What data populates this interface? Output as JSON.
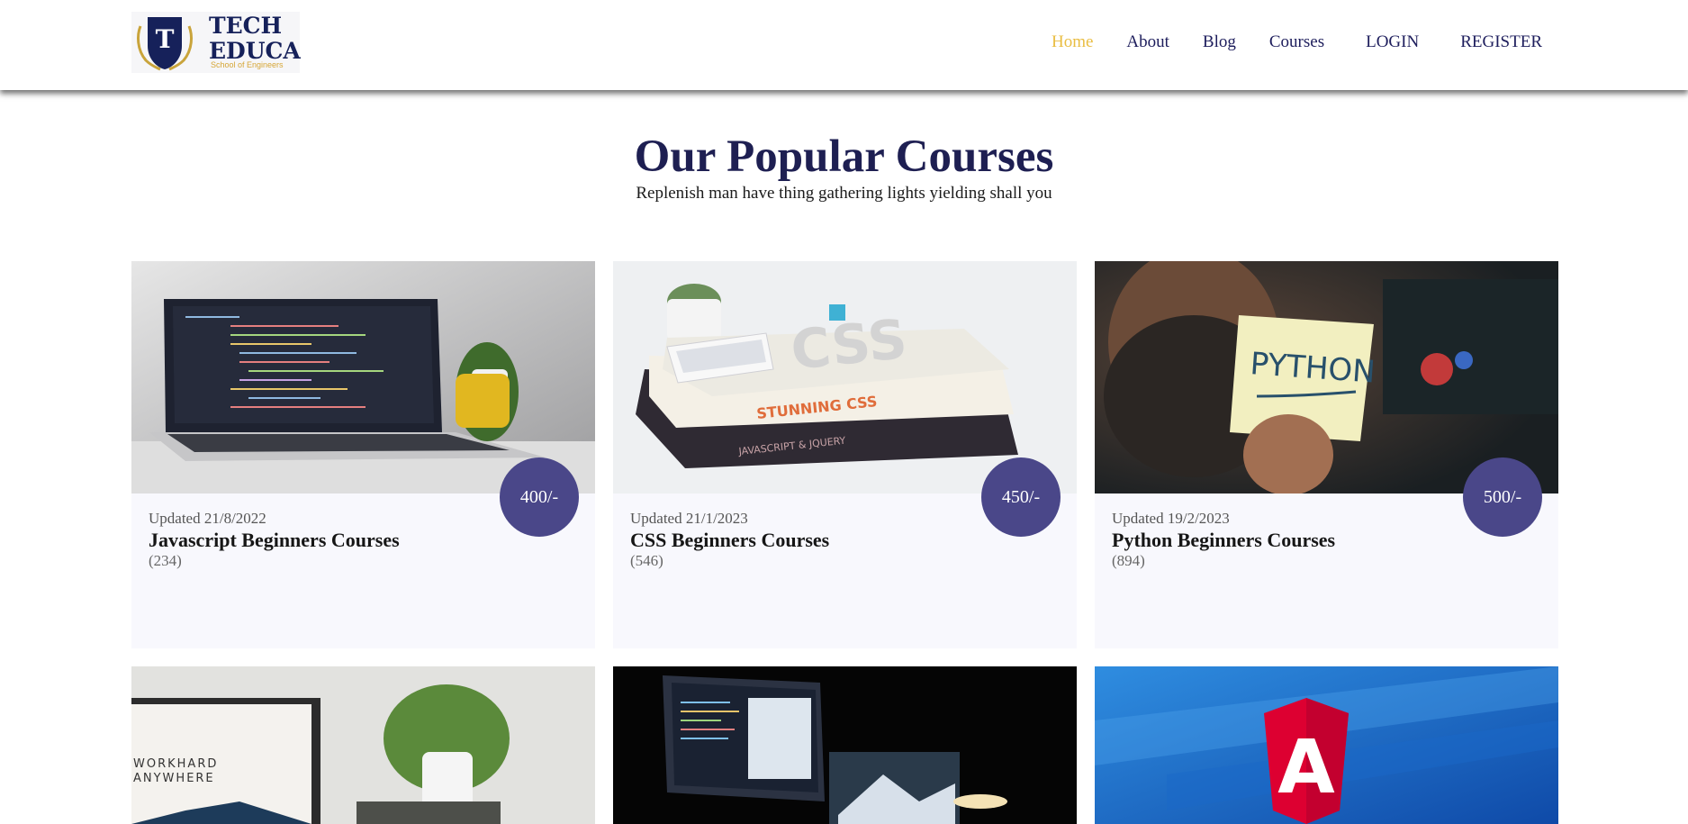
{
  "logo": {
    "line1": "TECH",
    "line2": "EDUCA",
    "tagline": "School of Engineers",
    "mark": "T"
  },
  "nav": [
    {
      "label": "Home",
      "active": true
    },
    {
      "label": "About"
    },
    {
      "label": "Blog"
    },
    {
      "label": "Courses"
    },
    {
      "label": "LOGIN"
    },
    {
      "label": "REGISTER"
    }
  ],
  "section": {
    "title": "Our Popular Courses",
    "subtitle": "Replenish man have thing gathering lights yielding shall you"
  },
  "courses": [
    {
      "updated": "Updated 21/8/2022",
      "title": "Javascript Beginners Courses",
      "count": "(234)",
      "price": "400/-",
      "image": "laptop-code-image"
    },
    {
      "updated": "Updated 21/1/2023",
      "title": "CSS Beginners Courses",
      "count": "(546)",
      "price": "450/-",
      "image": "css-books-image"
    },
    {
      "updated": "Updated 19/2/2023",
      "title": "Python Beginners Courses",
      "count": "(894)",
      "price": "500/-",
      "image": "python-note-image"
    }
  ],
  "more_courses": [
    {
      "image": "workhard-laptop-image",
      "caption_line1": "WORKHARD",
      "caption_line2": "ANYWHERE"
    },
    {
      "image": "dark-desk-computer-image"
    },
    {
      "image": "angular-logo-image",
      "mark": "A"
    }
  ],
  "colors": {
    "accent": "#e9bd42",
    "brand": "#1e1f52",
    "price_badge": "#4a4789"
  }
}
